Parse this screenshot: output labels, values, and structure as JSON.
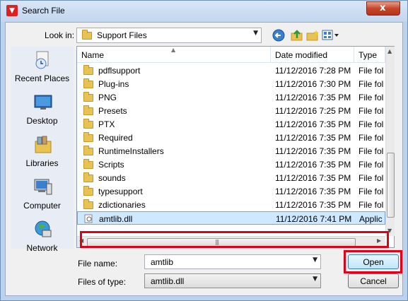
{
  "window": {
    "title": "Search File",
    "close_glyph": "x"
  },
  "toolbar": {
    "look_in_label": "Look in:",
    "look_in_value": "Support Files",
    "icons": [
      "back-icon",
      "up-folder-icon",
      "new-folder-icon",
      "view-menu-icon"
    ]
  },
  "places": [
    {
      "label": "Recent Places",
      "icon": "recent-places-icon"
    },
    {
      "label": "Desktop",
      "icon": "desktop-icon"
    },
    {
      "label": "Libraries",
      "icon": "libraries-icon"
    },
    {
      "label": "Computer",
      "icon": "computer-icon"
    },
    {
      "label": "Network",
      "icon": "network-icon"
    }
  ],
  "columns": {
    "name": "Name",
    "date": "Date modified",
    "type": "Type"
  },
  "files": [
    {
      "name": "pdflsupport",
      "date": "11/12/2016 7:28 PM",
      "type": "File fol",
      "kind": "folder"
    },
    {
      "name": "Plug-ins",
      "date": "11/12/2016 7:30 PM",
      "type": "File fol",
      "kind": "folder"
    },
    {
      "name": "PNG",
      "date": "11/12/2016 7:35 PM",
      "type": "File fol",
      "kind": "folder"
    },
    {
      "name": "Presets",
      "date": "11/12/2016 7:25 PM",
      "type": "File fol",
      "kind": "folder"
    },
    {
      "name": "PTX",
      "date": "11/12/2016 7:35 PM",
      "type": "File fol",
      "kind": "folder"
    },
    {
      "name": "Required",
      "date": "11/12/2016 7:35 PM",
      "type": "File fol",
      "kind": "folder"
    },
    {
      "name": "RuntimeInstallers",
      "date": "11/12/2016 7:35 PM",
      "type": "File fol",
      "kind": "folder"
    },
    {
      "name": "Scripts",
      "date": "11/12/2016 7:35 PM",
      "type": "File fol",
      "kind": "folder"
    },
    {
      "name": "sounds",
      "date": "11/12/2016 7:35 PM",
      "type": "File fol",
      "kind": "folder"
    },
    {
      "name": "typesupport",
      "date": "11/12/2016 7:35 PM",
      "type": "File fol",
      "kind": "folder"
    },
    {
      "name": "zdictionaries",
      "date": "11/12/2016 7:35 PM",
      "type": "File fol",
      "kind": "folder"
    },
    {
      "name": "amtlib.dll",
      "date": "11/12/2016 7:41 PM",
      "type": "Applic",
      "kind": "dll",
      "selected": true
    }
  ],
  "form": {
    "file_name_label": "File name:",
    "file_name_value": "amtlib",
    "file_type_label": "Files of type:",
    "file_type_value": "amtlib.dll",
    "open_label": "Open",
    "cancel_label": "Cancel"
  },
  "colors": {
    "highlight_box": "#e00018",
    "selection": "#cde8ff",
    "folder": "#e8c252"
  }
}
